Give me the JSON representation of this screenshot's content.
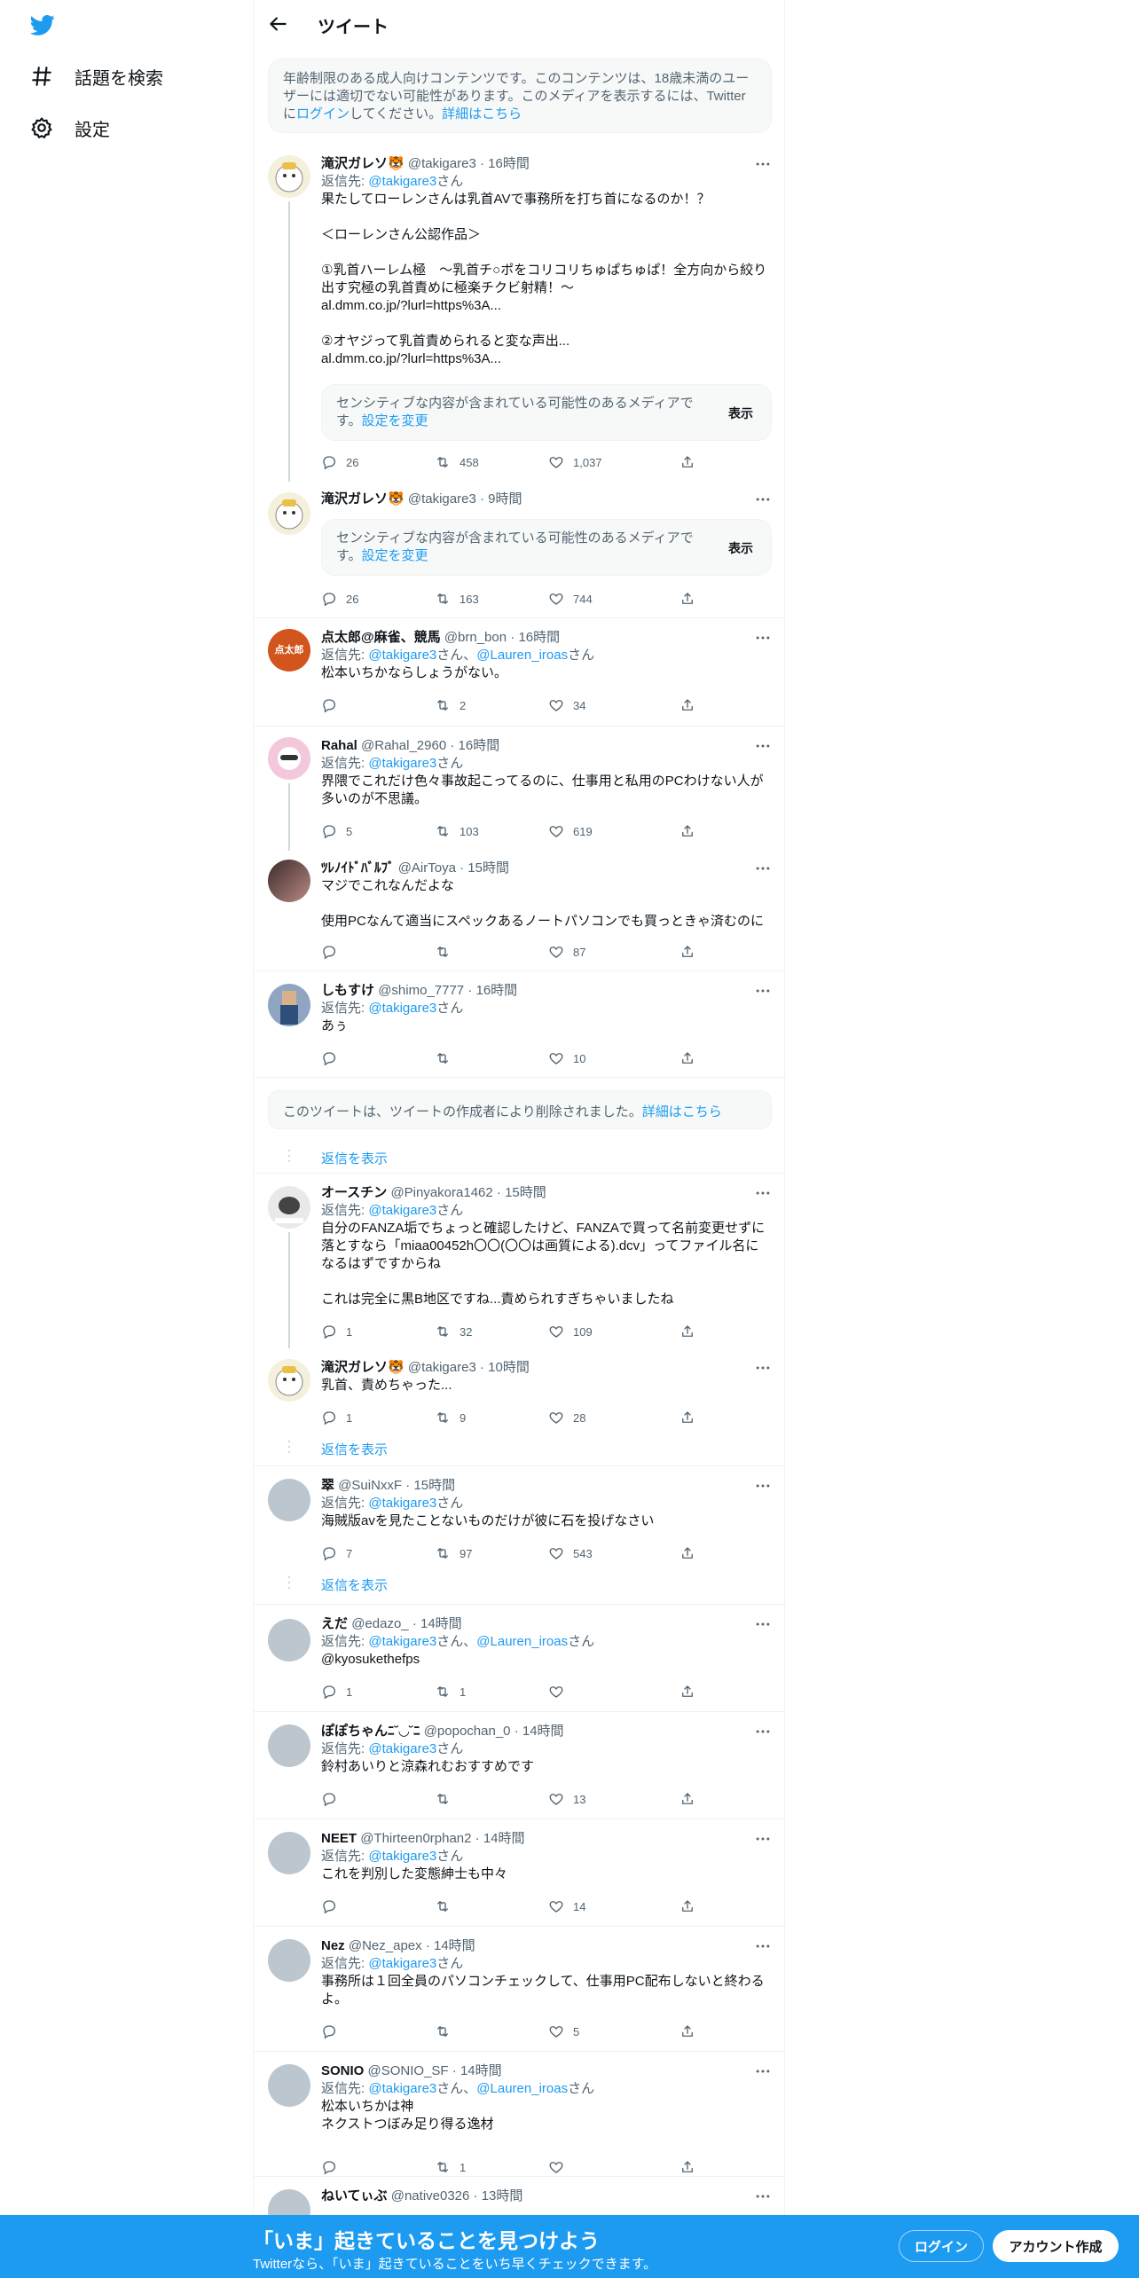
{
  "nav": {
    "explore_label": "話題を検索",
    "settings_label": "設定"
  },
  "topbar": {
    "title": "ツイート"
  },
  "notice": {
    "text_before": "年齢制限のある成人向けコンテンツです。このコンテンツは、18歳未満のユーザーには適切でない可能性があります。このメディアを表示するには、Twitterに",
    "login_link": "ログイン",
    "text_after": "してください。",
    "details_link": "詳細はこちら"
  },
  "tweets": [
    {
      "name": "滝沢ガレソ🐯",
      "handle": "@takigare3",
      "time": "16時間",
      "reply_prefix": "返信先: ",
      "reply_to": "@takigare3",
      "reply_suffix": "さん",
      "text1": "果たしてローレンさんは乳首AVで事務所を打ち首になるのか！？\n\n＜ローレンさん公認作品＞\n\n①乳首ハーレム極　〜乳首チ○ポをコリコリちゅぱちゅぱ！全方向から絞り出す究極の乳首責めに極楽チクビ射精！〜",
      "link1": "al.dmm.co.jp/?lurl=https%3A...",
      "text2": "②オヤジって乳首責められると変な声出...",
      "link2": "al.dmm.co.jp/?lurl=https%3A...",
      "sensitive_text": "センシティブな内容が含まれている可能性のあるメディアです。",
      "sensitive_link": "設定を変更",
      "show_label": "表示",
      "replies": "26",
      "retweets": "458",
      "likes": "1,037"
    },
    {
      "name": "滝沢ガレソ🐯",
      "handle": "@takigare3",
      "time": "9時間",
      "sensitive_text": "センシティブな内容が含まれている可能性のあるメディアです。",
      "sensitive_link": "設定を変更",
      "show_label": "表示",
      "replies": "26",
      "retweets": "163",
      "likes": "744"
    },
    {
      "name": "点太郎@麻雀、競馬",
      "handle": "@brn_bon",
      "time": "16時間",
      "avatar_text": "点太郎",
      "reply_prefix": "返信先: ",
      "reply_to": "@takigare3",
      "reply_mid": "さん、",
      "reply_to2": "@Lauren_iroas",
      "reply_suffix": "さん",
      "text": "松本いちかならしょうがない。",
      "replies": "",
      "retweets": "2",
      "likes": "34"
    },
    {
      "name": "Rahal",
      "handle": "@Rahal_2960",
      "time": "16時間",
      "reply_prefix": "返信先: ",
      "reply_to": "@takigare3",
      "reply_suffix": "さん",
      "text": "界隈でこれだけ色々事故起こってるのに、仕事用と私用のPCわけない人が多いのが不思議。",
      "replies": "5",
      "retweets": "103",
      "likes": "619"
    },
    {
      "name": "ﾂﾚﾉｲﾄﾞﾊﾞﾙﾌﾞ",
      "handle": "@AirToya",
      "time": "15時間",
      "text": "マジでこれなんだよな\n\n使用PCなんて適当にスペックあるノートパソコンでも買っときゃ済むのに",
      "replies": "",
      "retweets": "",
      "likes": "87"
    },
    {
      "name": "しもすけ",
      "handle": "@shimo_7777",
      "time": "16時間",
      "reply_prefix": "返信先: ",
      "reply_to": "@takigare3",
      "reply_suffix": "さん",
      "text": "あぅ",
      "replies": "",
      "retweets": "",
      "likes": "10"
    },
    {
      "name": "オースチン",
      "handle": "@Pinyakora1462",
      "time": "15時間",
      "reply_prefix": "返信先: ",
      "reply_to": "@takigare3",
      "reply_suffix": "さん",
      "text": "自分のFANZA垢でちょっと確認したけど、FANZAで買って名前変更せずに落とすなら「miaa00452h〇〇(〇〇は画質による).dcv」ってファイル名になるはずですからね\n\nこれは完全に黒B地区ですね...責められすぎちゃいましたね",
      "replies": "1",
      "retweets": "32",
      "likes": "109"
    },
    {
      "name": "滝沢ガレソ🐯",
      "handle": "@takigare3",
      "time": "10時間",
      "text": "乳首、責めちゃった...",
      "replies": "1",
      "retweets": "9",
      "likes": "28"
    },
    {
      "name": "翠",
      "handle": "@SuiNxxF",
      "time": "15時間",
      "reply_prefix": "返信先: ",
      "reply_to": "@takigare3",
      "reply_suffix": "さん",
      "text": "海賊版avを見たことないものだけが彼に石を投げなさい",
      "replies": "7",
      "retweets": "97",
      "likes": "543"
    },
    {
      "name": "えだ",
      "handle": "@edazo_",
      "time": "14時間",
      "reply_prefix": "返信先: ",
      "reply_to": "@takigare3",
      "reply_mid": "さん、",
      "reply_to2": "@Lauren_iroas",
      "reply_suffix": "さん",
      "mention": "@kyosukethefps",
      "replies": "1",
      "retweets": "1",
      "likes": ""
    },
    {
      "name": "ぽぽちゃんﾆ˘◡˘ﾆ",
      "handle": "@popochan_0",
      "time": "14時間",
      "reply_prefix": "返信先: ",
      "reply_to": "@takigare3",
      "reply_suffix": "さん",
      "text": "鈴村あいりと涼森れむおすすめです",
      "replies": "",
      "retweets": "",
      "likes": "13"
    },
    {
      "name": "NEET",
      "handle": "@Thirteen0rphan2",
      "time": "14時間",
      "reply_prefix": "返信先: ",
      "reply_to": "@takigare3",
      "reply_suffix": "さん",
      "text": "これを判別した変態紳士も中々",
      "replies": "",
      "retweets": "",
      "likes": "14"
    },
    {
      "name": "Nez",
      "handle": "@Nez_apex",
      "time": "14時間",
      "reply_prefix": "返信先: ",
      "reply_to": "@takigare3",
      "reply_suffix": "さん",
      "text": "事務所は１回全員のパソコンチェックして、仕事用PC配布しないと終わるよ。",
      "replies": "",
      "retweets": "",
      "likes": "5"
    },
    {
      "name": "SONIO",
      "handle": "@SONIO_SF",
      "time": "14時間",
      "reply_prefix": "返信先: ",
      "reply_to": "@takigare3",
      "reply_mid": "さん、",
      "reply_to2": "@Lauren_iroas",
      "reply_suffix": "さん",
      "text": "松本いちかは神\nネクストつぼみ足り得る逸材",
      "replies": "",
      "retweets": "1",
      "likes": ""
    },
    {
      "name": "ねいてぃぶ",
      "handle": "@native0326",
      "time": "13時間"
    }
  ],
  "deleted_notice": {
    "text": "このツイートは、ツイートの作成者により削除されました。",
    "link": "詳細はこちら"
  },
  "show_replies_label": "返信を表示",
  "banner": {
    "title": "「いま」起きていることを見つけよう",
    "subtitle": "Twitterなら、「いま」起きていることをいち早くチェックできます。",
    "login_label": "ログイン",
    "signup_label": "アカウント作成"
  },
  "colors": {
    "accent": "#1d9bf0",
    "text": "#0f1419",
    "muted": "#536471"
  }
}
